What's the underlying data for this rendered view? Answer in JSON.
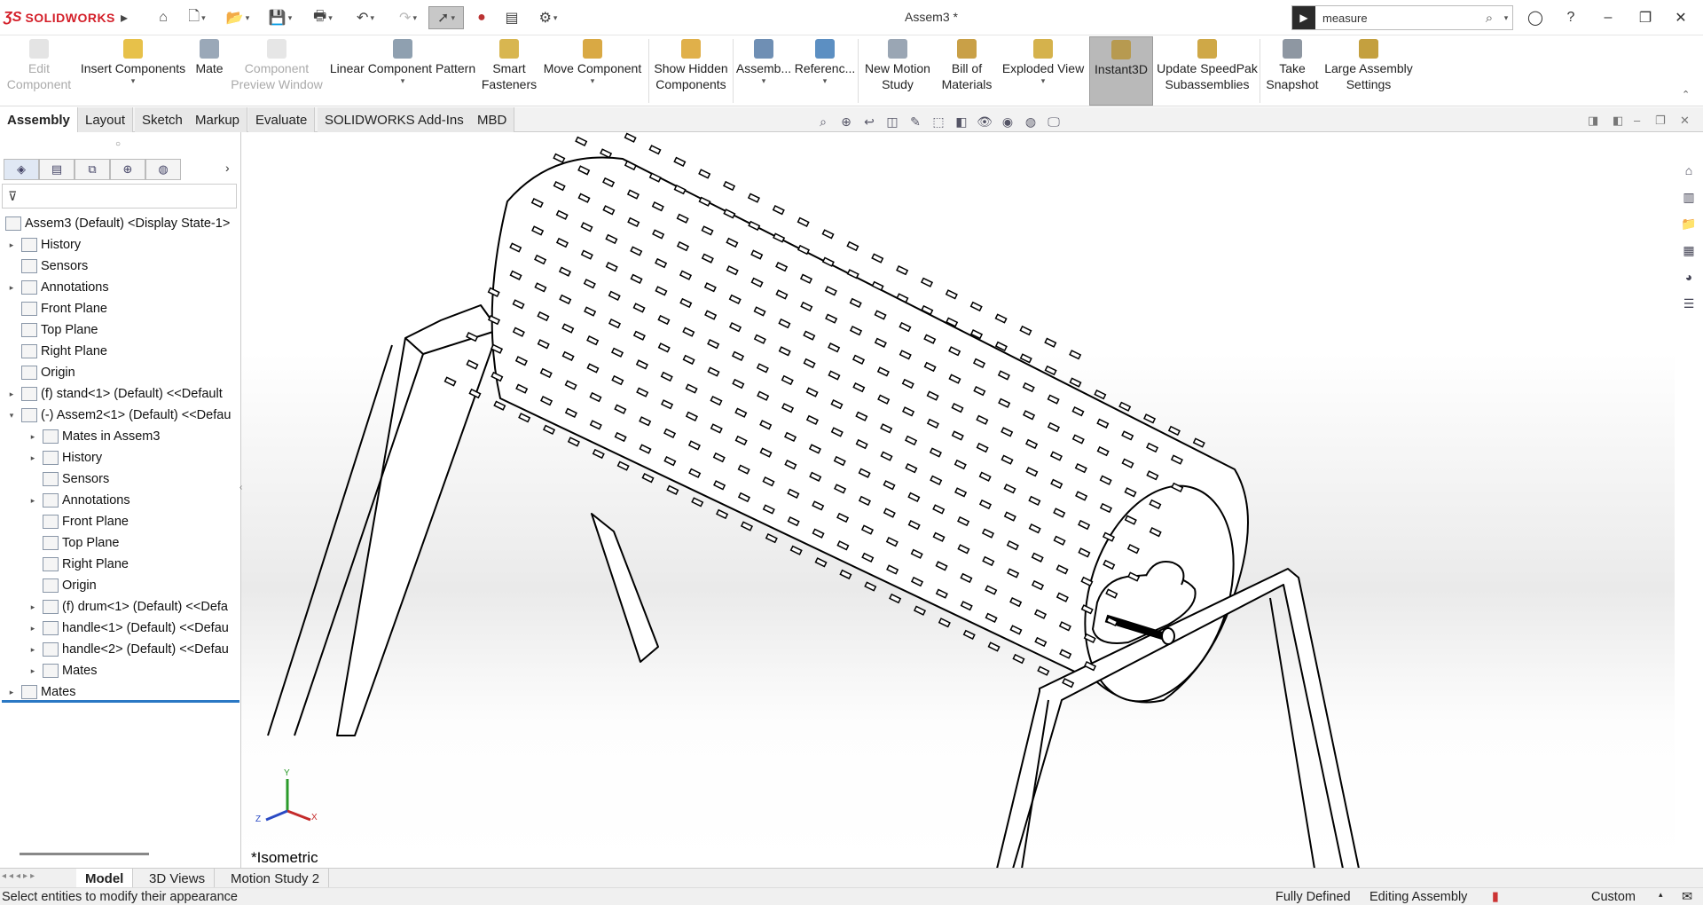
{
  "app": {
    "brand": "SOLIDWORKS",
    "document_title": "Assem3 *"
  },
  "search": {
    "value": "measure"
  },
  "ribbon": [
    {
      "label1": "Edit",
      "label2": "Component",
      "disabled": true
    },
    {
      "label1": "Insert Components",
      "label2": ""
    },
    {
      "label1": "Mate",
      "label2": ""
    },
    {
      "label1": "Component",
      "label2": "Preview Window",
      "disabled": true
    },
    {
      "label1": "Linear Component Pattern",
      "label2": ""
    },
    {
      "label1": "Smart",
      "label2": "Fasteners"
    },
    {
      "label1": "Move Component",
      "label2": ""
    },
    {
      "label1": "Show Hidden",
      "label2": "Components"
    },
    {
      "label1": "Assemb...",
      "label2": ""
    },
    {
      "label1": "Referenc...",
      "label2": ""
    },
    {
      "label1": "New Motion",
      "label2": "Study"
    },
    {
      "label1": "Bill of",
      "label2": "Materials"
    },
    {
      "label1": "Exploded View",
      "label2": ""
    },
    {
      "label1": "Instant3D",
      "label2": ""
    },
    {
      "label1": "Update SpeedPak",
      "label2": "Subassemblies"
    },
    {
      "label1": "Take",
      "label2": "Snapshot"
    },
    {
      "label1": "Large Assembly",
      "label2": "Settings"
    }
  ],
  "tabs": [
    "Assembly",
    "Layout",
    "Sketch",
    "Markup",
    "Evaluate",
    "SOLIDWORKS Add-Ins",
    "MBD"
  ],
  "tree": [
    {
      "label": "Assem3 (Default) <Display State-1>",
      "level": 0,
      "expander": ""
    },
    {
      "label": "History",
      "level": 1,
      "expander": "▸"
    },
    {
      "label": "Sensors",
      "level": 1,
      "expander": ""
    },
    {
      "label": "Annotations",
      "level": 1,
      "expander": "▸"
    },
    {
      "label": "Front Plane",
      "level": 1,
      "expander": ""
    },
    {
      "label": "Top Plane",
      "level": 1,
      "expander": ""
    },
    {
      "label": "Right Plane",
      "level": 1,
      "expander": ""
    },
    {
      "label": "Origin",
      "level": 1,
      "expander": ""
    },
    {
      "label": "(f) stand<1> (Default) <<Default",
      "level": 1,
      "expander": "▸"
    },
    {
      "label": "(-) Assem2<1> (Default) <<Defau",
      "level": 1,
      "expander": "▾"
    },
    {
      "label": "Mates in Assem3",
      "level": 2,
      "expander": "▸"
    },
    {
      "label": "History",
      "level": 2,
      "expander": "▸"
    },
    {
      "label": "Sensors",
      "level": 2,
      "expander": ""
    },
    {
      "label": "Annotations",
      "level": 2,
      "expander": "▸"
    },
    {
      "label": "Front Plane",
      "level": 2,
      "expander": ""
    },
    {
      "label": "Top Plane",
      "level": 2,
      "expander": ""
    },
    {
      "label": "Right Plane",
      "level": 2,
      "expander": ""
    },
    {
      "label": "Origin",
      "level": 2,
      "expander": ""
    },
    {
      "label": "(f) drum<1> (Default) <<Defa",
      "level": 2,
      "expander": "▸"
    },
    {
      "label": "handle<1> (Default) <<Defau",
      "level": 2,
      "expander": "▸"
    },
    {
      "label": "handle<2> (Default) <<Defau",
      "level": 2,
      "expander": "▸"
    },
    {
      "label": "Mates",
      "level": 2,
      "expander": "▸"
    },
    {
      "label": "Mates",
      "level": 1,
      "expander": "▸"
    }
  ],
  "viewport": {
    "view_label": "*Isometric",
    "triad": {
      "x": "X",
      "y": "Y",
      "z": "Z"
    }
  },
  "bottom_tabs": [
    "Model",
    "3D Views",
    "Motion Study 2"
  ],
  "status": {
    "message": "Select entities to modify their appearance",
    "defined": "Fully Defined",
    "mode": "Editing Assembly",
    "units": "Custom"
  }
}
